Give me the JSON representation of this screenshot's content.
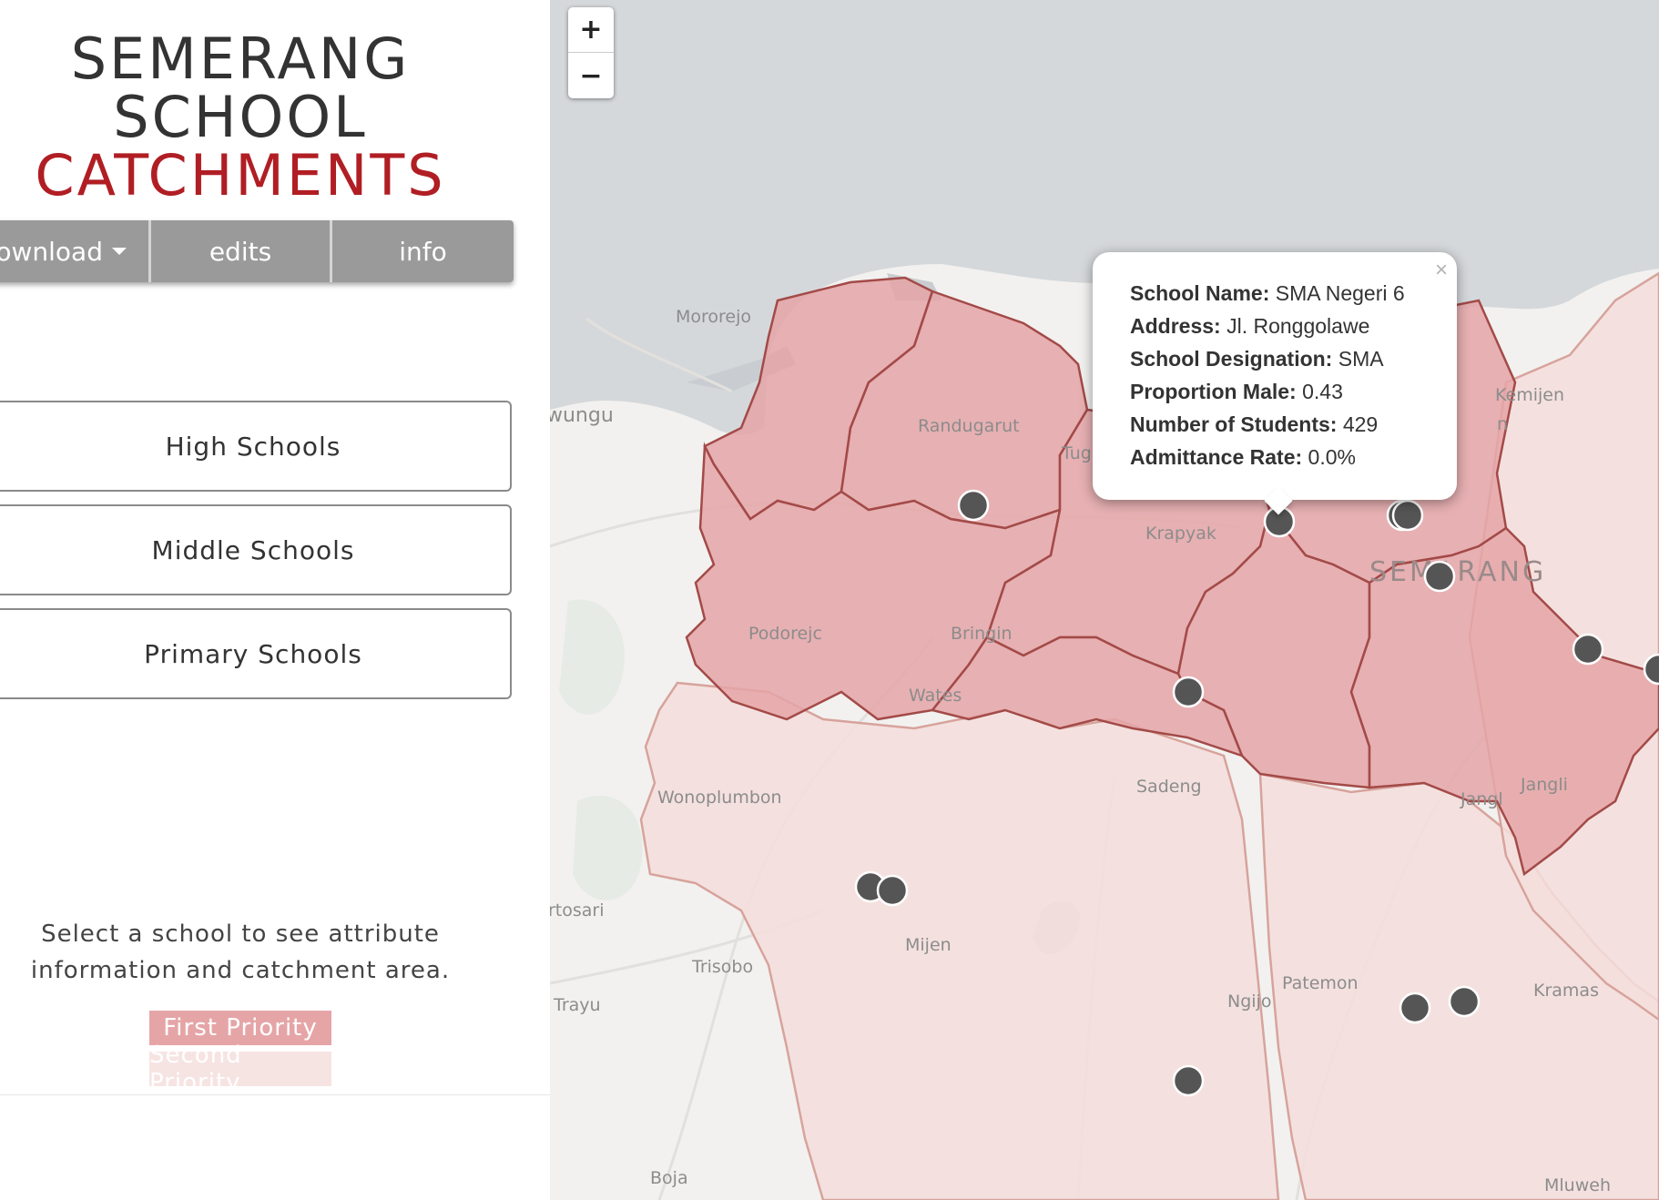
{
  "header": {
    "title_line1": "SEMERANG",
    "title_line2": "SCHOOL",
    "title_line3": "CATCHMENTS",
    "accent_color": "#b01e24"
  },
  "toolbar": {
    "download_label": "download",
    "edits_label": "edits",
    "info_label": "info"
  },
  "school_types": {
    "high": "High Schools",
    "middle": "Middle Schools",
    "primary": "Primary Schools"
  },
  "instructions": "Select a school to see attribute information and catchment area.",
  "legend": {
    "first": {
      "label": "First Priority",
      "color": "#e5a5a7"
    },
    "second": {
      "label": "Second Priority",
      "color": "#f6e4e3"
    }
  },
  "map": {
    "zoom_in": "+",
    "zoom_out": "−",
    "places": {
      "mororejo": "Mororejo",
      "wungu": "wungu",
      "randugarut": "Randugarut",
      "tugu": "Tug",
      "kemijen": "Kemijen",
      "krapyak": "Krapyak",
      "semarang": "SEMARANG",
      "podorejo": "Podorejc",
      "bringin": "Bringin",
      "wates": "Wates",
      "wonoplumbon": "Wonoplumbon",
      "sadeng": "Sadeng",
      "jangli": "Jangli",
      "jangli2": "Jangl",
      "tosari": "rtosari",
      "mijen": "Mijen",
      "trisobo": "Trisobo",
      "trayu": "Trayu",
      "ngijo": "Ngijo",
      "patemon": "Patemon",
      "kramas": "Kramas",
      "boja": "Boja",
      "mluweh": "Mluweh",
      "n_label": "n"
    }
  },
  "popup": {
    "close": "×",
    "school_name_key": "School Name:",
    "school_name": "SMA Negeri 6",
    "address_key": "Address:",
    "address": "Jl. Ronggolawe",
    "designation_key": "School Designation:",
    "designation": "SMA",
    "proportion_key": "Proportion Male:",
    "proportion": "0.43",
    "students_key": "Number of Students:",
    "students": "429",
    "admittance_key": "Admittance Rate:",
    "admittance": "0.0%"
  }
}
